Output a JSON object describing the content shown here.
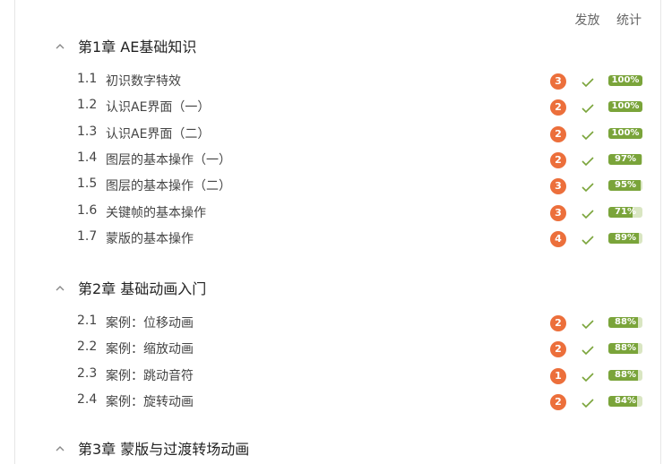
{
  "topbar": {
    "publish": "发放",
    "stats": "统计"
  },
  "chapters": [
    {
      "title": "第1章 AE基础知识",
      "lessons": [
        {
          "num": "1.1",
          "title": "初识数字特效",
          "badge": "3",
          "progress": 100,
          "progress_label": "100%"
        },
        {
          "num": "1.2",
          "title": "认识AE界面（一）",
          "badge": "2",
          "progress": 100,
          "progress_label": "100%"
        },
        {
          "num": "1.3",
          "title": "认识AE界面（二）",
          "badge": "2",
          "progress": 100,
          "progress_label": "100%"
        },
        {
          "num": "1.4",
          "title": "图层的基本操作（一）",
          "badge": "2",
          "progress": 97,
          "progress_label": "97%"
        },
        {
          "num": "1.5",
          "title": "图层的基本操作（二）",
          "badge": "3",
          "progress": 95,
          "progress_label": "95%"
        },
        {
          "num": "1.6",
          "title": "关键帧的基本操作",
          "badge": "3",
          "progress": 71,
          "progress_label": "71%"
        },
        {
          "num": "1.7",
          "title": "蒙版的基本操作",
          "badge": "4",
          "progress": 89,
          "progress_label": "89%"
        }
      ]
    },
    {
      "title": "第2章 基础动画入门",
      "lessons": [
        {
          "num": "2.1",
          "title": "案例：位移动画",
          "badge": "2",
          "progress": 88,
          "progress_label": "88%"
        },
        {
          "num": "2.2",
          "title": "案例：缩放动画",
          "badge": "2",
          "progress": 88,
          "progress_label": "88%"
        },
        {
          "num": "2.3",
          "title": "案例：跳动音符",
          "badge": "1",
          "progress": 88,
          "progress_label": "88%"
        },
        {
          "num": "2.4",
          "title": "案例：旋转动画",
          "badge": "2",
          "progress": 84,
          "progress_label": "84%"
        }
      ]
    },
    {
      "title": "第3章 蒙版与过渡转场动画",
      "lessons": []
    }
  ],
  "colors": {
    "badge": "#ec6f3b",
    "check": "#7aa43a",
    "progress": "#7aa43a",
    "progress_track": "#d9e6c2"
  }
}
